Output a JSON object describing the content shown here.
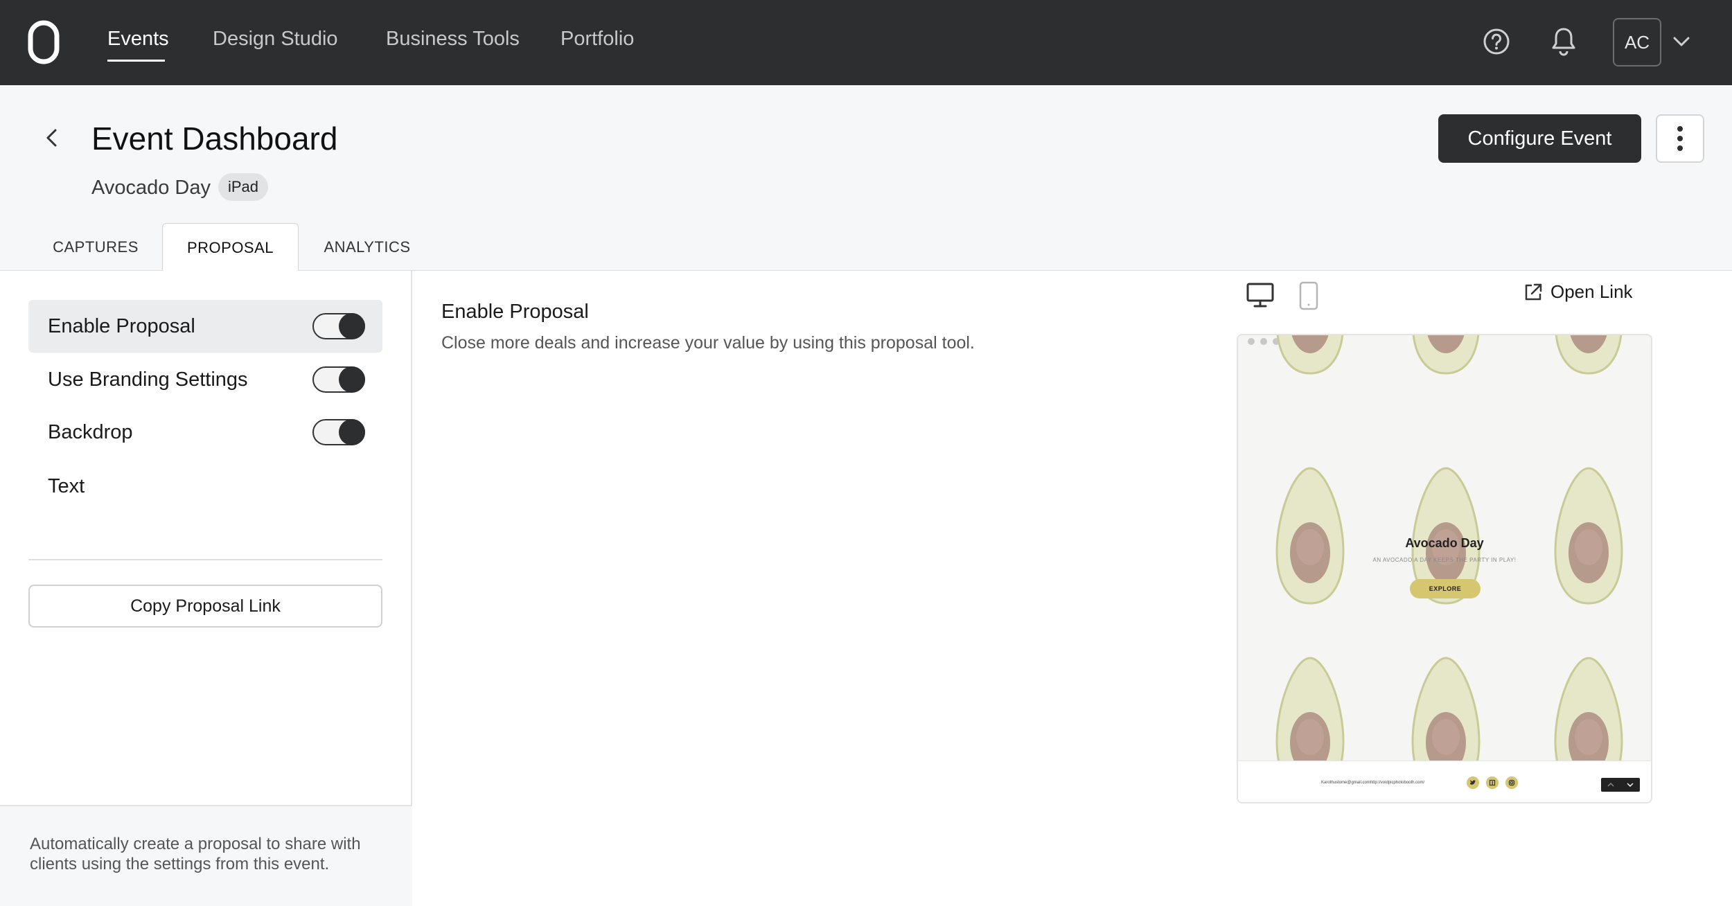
{
  "nav": {
    "items": [
      {
        "label": "Events",
        "active": true
      },
      {
        "label": "Design Studio",
        "active": false
      },
      {
        "label": "Business Tools",
        "active": false
      },
      {
        "label": "Portfolio",
        "active": false
      }
    ],
    "avatar_initials": "AC",
    "icons": [
      "logo-icon",
      "help-icon",
      "bell-icon",
      "chevron-down-icon"
    ]
  },
  "header": {
    "title": "Event Dashboard",
    "event_name": "Avocado Day",
    "device_badge": "iPad",
    "configure_label": "Configure Event"
  },
  "tabs": [
    {
      "label": "CAPTURES",
      "active": false
    },
    {
      "label": "PROPOSAL",
      "active": true
    },
    {
      "label": "ANALYTICS",
      "active": false
    }
  ],
  "sidebar": {
    "toggles": [
      {
        "label": "Enable Proposal",
        "on": true
      },
      {
        "label": "Use Branding Settings",
        "on": true
      },
      {
        "label": "Backdrop",
        "on": true
      }
    ],
    "text_item": "Text",
    "copy_link_label": "Copy Proposal Link",
    "footer_text": "Automatically create a proposal to share with clients using the settings from this event."
  },
  "main": {
    "title": "Enable Proposal",
    "description": "Close more deals and increase your value by using this proposal tool.",
    "open_link_label": "Open Link",
    "preview_mode": "desktop"
  },
  "preview": {
    "title": "Avocado Day",
    "subtitle": "AN AVOCADO A DAY KEEPS THE PARTY IN PLAY!",
    "button_label": "EXPLORE",
    "footer_text": "Karothustome@gmail.comhttp://voidpicphotobooth.com/",
    "accent_color": "#d6c670"
  },
  "colors": {
    "nav_bg": "#2d2e30",
    "header_bg": "#f6f7f9",
    "primary_button": "#2d2e30"
  }
}
